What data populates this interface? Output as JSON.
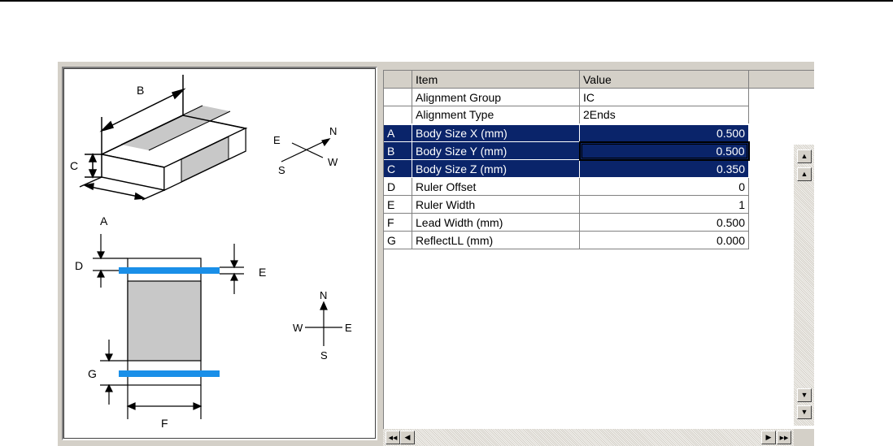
{
  "diagram": {
    "top_view_labels": {
      "b": "B",
      "c": "C",
      "a": "A"
    },
    "side_view_labels": {
      "d": "D",
      "e": "E",
      "g": "G",
      "f": "F"
    },
    "compass_iso": {
      "n": "N",
      "e": "E",
      "s": "S",
      "w": "W"
    },
    "compass_plan": {
      "n": "N",
      "e": "E",
      "s": "S",
      "w": "W"
    },
    "colors": {
      "ruler_blue": "#1a8fe8",
      "body_gray": "#c8c8c8",
      "end_white": "#ffffff"
    }
  },
  "grid": {
    "headers": {
      "item": "Item",
      "value": "Value"
    },
    "fixed_rows": [
      {
        "item": "Alignment Group",
        "value": "IC"
      },
      {
        "item": "Alignment Type",
        "value": "2Ends"
      }
    ],
    "rows": [
      {
        "code": "A",
        "item": "Body Size X (mm)",
        "value": "0.500"
      },
      {
        "code": "B",
        "item": "Body Size Y (mm)",
        "value": "0.500"
      },
      {
        "code": "C",
        "item": "Body Size Z (mm)",
        "value": "0.350"
      },
      {
        "code": "D",
        "item": "Ruler Offset",
        "value": "0"
      },
      {
        "code": "E",
        "item": "Ruler Width",
        "value": "1"
      },
      {
        "code": "F",
        "item": "Lead Width (mm)",
        "value": "0.500"
      },
      {
        "code": "G",
        "item": "ReflectLL (mm)",
        "value": "0.000"
      }
    ],
    "selection_color": "#0a246a"
  },
  "scroll": {
    "up_top_icon": "▲",
    "up_icon": "▲",
    "down_icon": "▼",
    "down_bottom_icon": "▼",
    "left_first_icon": "◀◀",
    "left_icon": "◀",
    "right_icon": "▶",
    "right_last_icon": "▶▶"
  }
}
